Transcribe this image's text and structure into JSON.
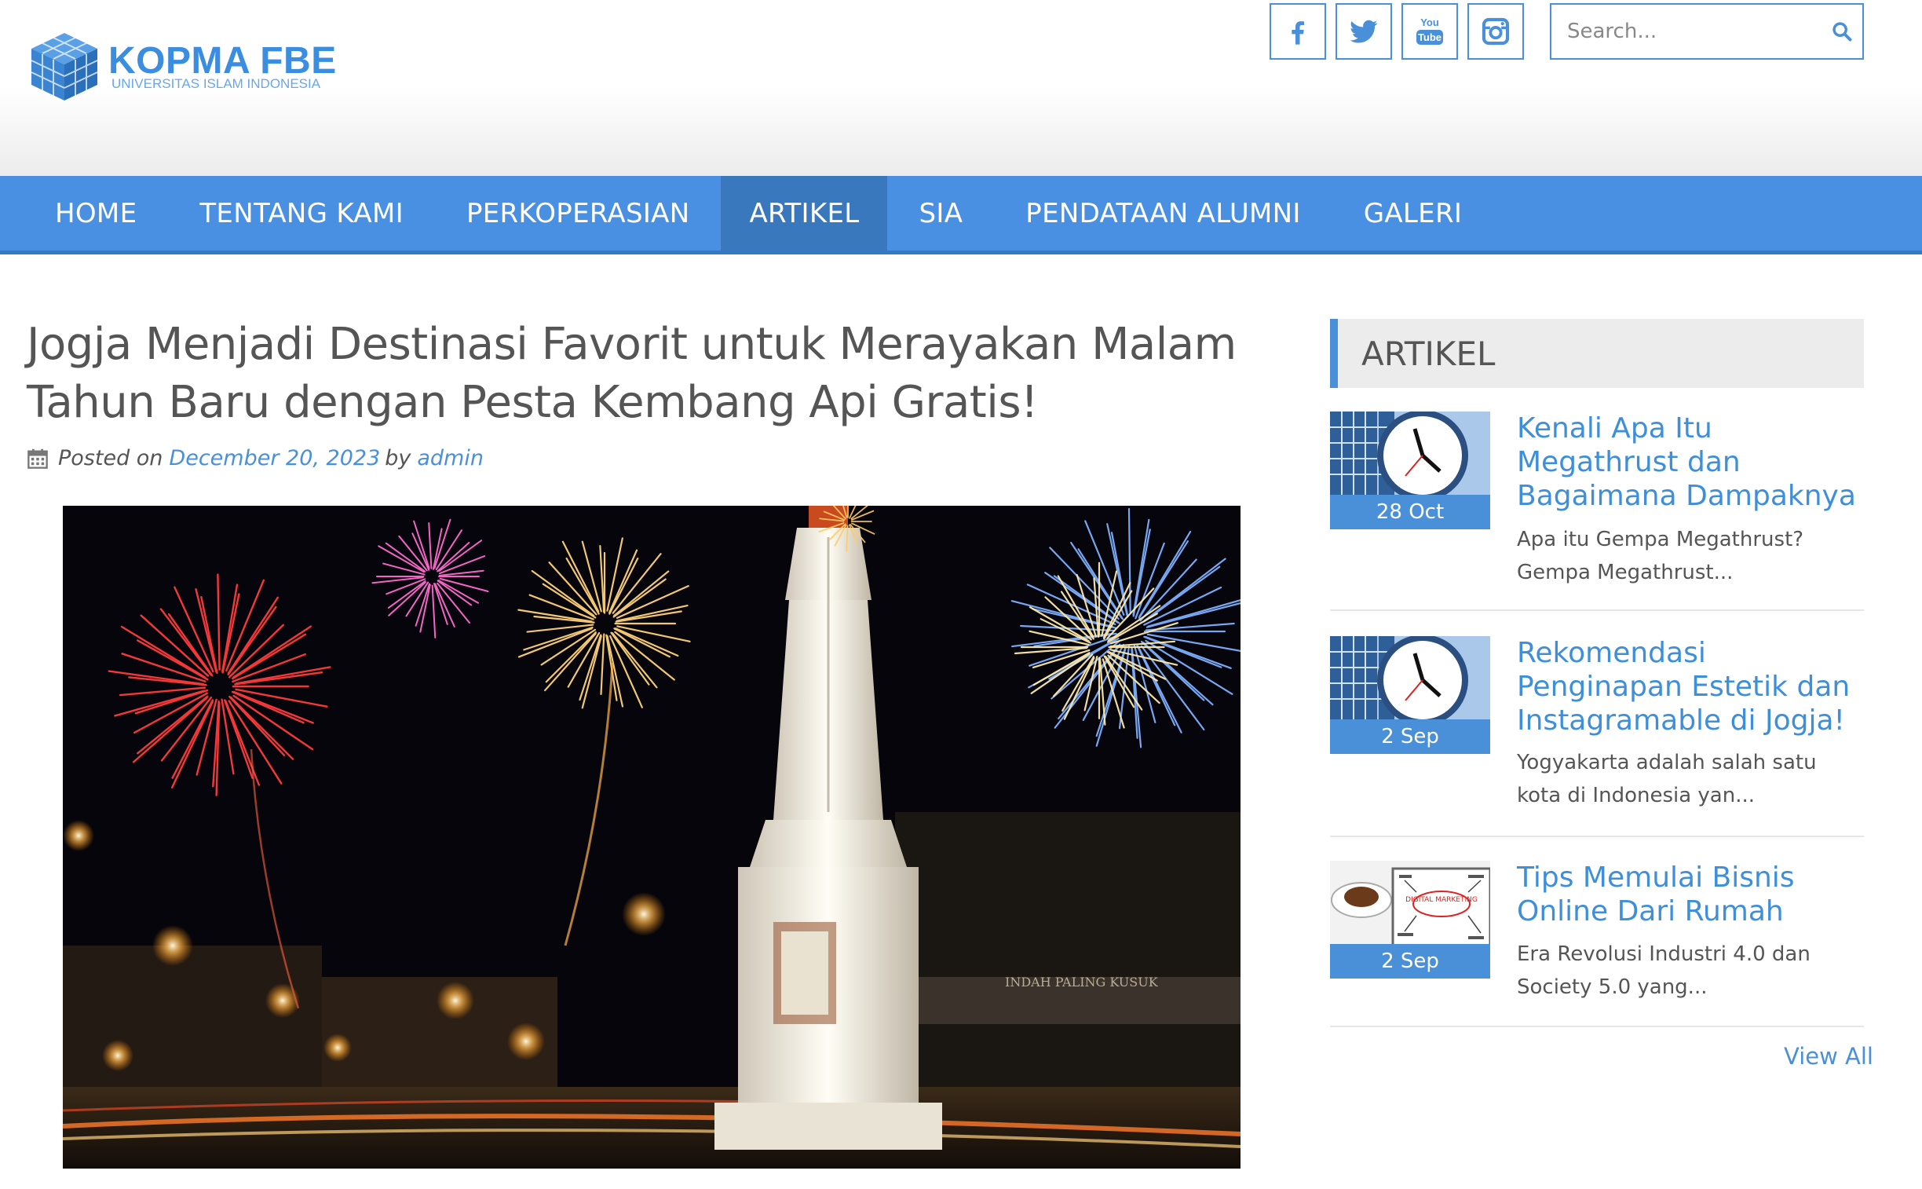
{
  "brand": {
    "title": "KOPMA FBE",
    "subtitle": "UNIVERSITAS ISLAM INDONESIA",
    "color": "#3b8de0"
  },
  "social": [
    {
      "name": "facebook-icon"
    },
    {
      "name": "twitter-icon"
    },
    {
      "name": "youtube-icon",
      "label_top": "You",
      "label_bottom": "Tube"
    },
    {
      "name": "instagram-icon"
    }
  ],
  "search": {
    "placeholder": "Search..."
  },
  "nav": {
    "items": [
      {
        "label": "HOME"
      },
      {
        "label": "TENTANG KAMI"
      },
      {
        "label": "PERKOPERASIAN"
      },
      {
        "label": "ARTIKEL",
        "active": true
      },
      {
        "label": "SIA"
      },
      {
        "label": "PENDATAAN ALUMNI"
      },
      {
        "label": "GALERI"
      }
    ],
    "color": "#4a90e2",
    "active_color": "#3a78be"
  },
  "post": {
    "title": "Jogja Menjadi Destinasi Favorit untuk Merayakan Malam Tahun Baru dengan Pesta Kembang Api Gratis!",
    "posted_on": "Posted on",
    "date": "December 20, 2023",
    "by": "by",
    "author": "admin",
    "image_sign_text": "INDAH PALING KUSUK"
  },
  "sidebar": {
    "heading": "ARTIKEL",
    "items": [
      {
        "date": "28 Oct",
        "title": "Kenali Apa Itu Megathrust dan Bagaimana Dampaknya",
        "excerpt": "Apa itu Gempa Megathrust? Gempa Megathrust..."
      },
      {
        "date": "2 Sep",
        "title": "Rekomendasi Penginapan Estetik dan Instagramable di Jogja!",
        "excerpt": "Yogyakarta adalah salah satu kota di Indonesia yan..."
      },
      {
        "date": "2 Sep",
        "title": "Tips Memulai Bisnis Online Dari Rumah",
        "excerpt": "Era Revolusi Industri 4.0 dan Society 5.0 yang...",
        "thumb_text": "DIGITAL MARKETING"
      }
    ],
    "view_all": "View All"
  }
}
